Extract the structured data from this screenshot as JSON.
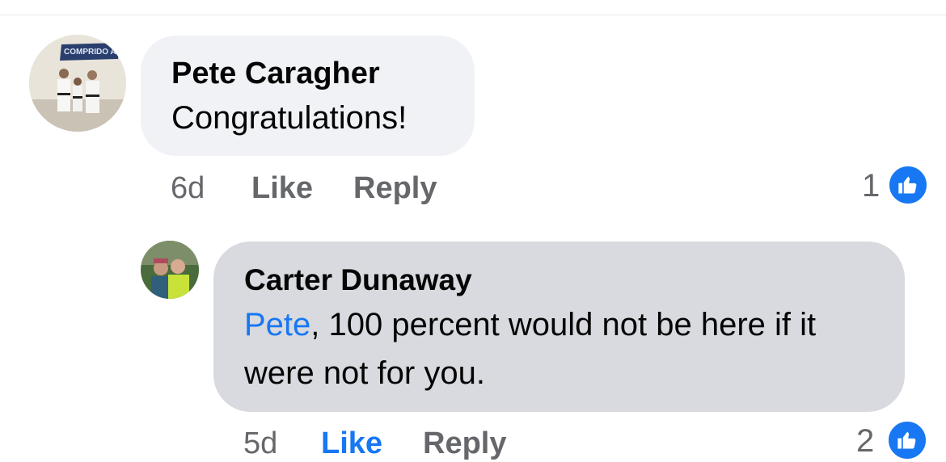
{
  "colors": {
    "accent": "#1877f2",
    "bubble_primary": "#f0f2f5",
    "bubble_reply": "#d8dadf",
    "meta_text": "#65676b"
  },
  "comments": [
    {
      "author": "Pete Caragher",
      "avatar_sign_text": "COMPRIDO Academy",
      "text": "Congratulations!",
      "time": "6d",
      "like_label": "Like",
      "like_active": false,
      "reply_label": "Reply",
      "reaction_count": "1",
      "reaction_icon": "thumbs-up-icon"
    },
    {
      "author": "Carter Dunaway",
      "mention": "Pete",
      "text": ", 100 percent would not be here if it were not for you.",
      "time": "5d",
      "like_label": "Like",
      "like_active": true,
      "reply_label": "Reply",
      "reaction_count": "2",
      "reaction_icon": "thumbs-up-icon"
    }
  ]
}
